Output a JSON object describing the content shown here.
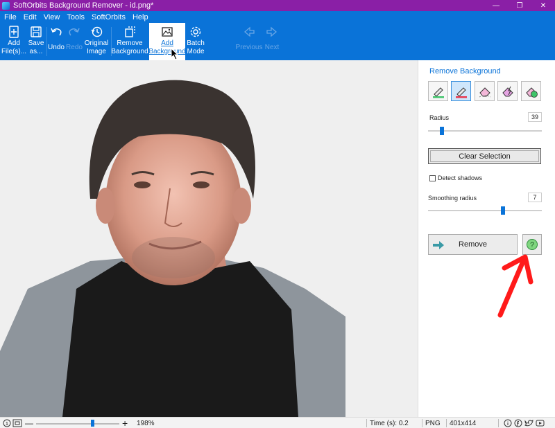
{
  "window": {
    "title": "SoftOrbits Background Remover - id.png*",
    "controls": {
      "minimize": "—",
      "maximize": "❐",
      "close": "✕"
    }
  },
  "menu": [
    "File",
    "Edit",
    "View",
    "Tools",
    "SoftOrbits",
    "Help"
  ],
  "toolbar": {
    "add_files": "Add\nFile(s)...",
    "save_as": "Save\nas...",
    "undo": "Undo",
    "redo": "Redo",
    "original_image": "Original\nImage",
    "remove_background": "Remove\nBackground",
    "add_background": "Add\nBackground",
    "batch_mode": "Batch\nMode",
    "previous": "Previous",
    "next": "Next"
  },
  "panel": {
    "title": "Remove Background",
    "tools": [
      "keep-marker-icon",
      "remove-marker-icon",
      "eraser-icon",
      "auto-eraser-icon",
      "clear-marks-icon"
    ],
    "radius_label": "Radius",
    "radius_value": "39",
    "radius_fraction": 0.12,
    "clear_selection": "Clear Selection",
    "detect_shadows": "Detect shadows",
    "detect_shadows_checked": false,
    "smoothing_label": "Smoothing radius",
    "smoothing_value": "7",
    "smoothing_fraction": 0.66,
    "remove_button": "Remove"
  },
  "status": {
    "zoom": "198%",
    "zoom_fraction": 0.68,
    "time": "Time (s): 0.2",
    "format": "PNG",
    "dimensions": "401x414"
  },
  "colors": {
    "titlebar": "#8a1fa6",
    "toolbar": "#0a73d8",
    "accent": "#0a73d8",
    "annotation_arrow": "#ff1a1a"
  }
}
